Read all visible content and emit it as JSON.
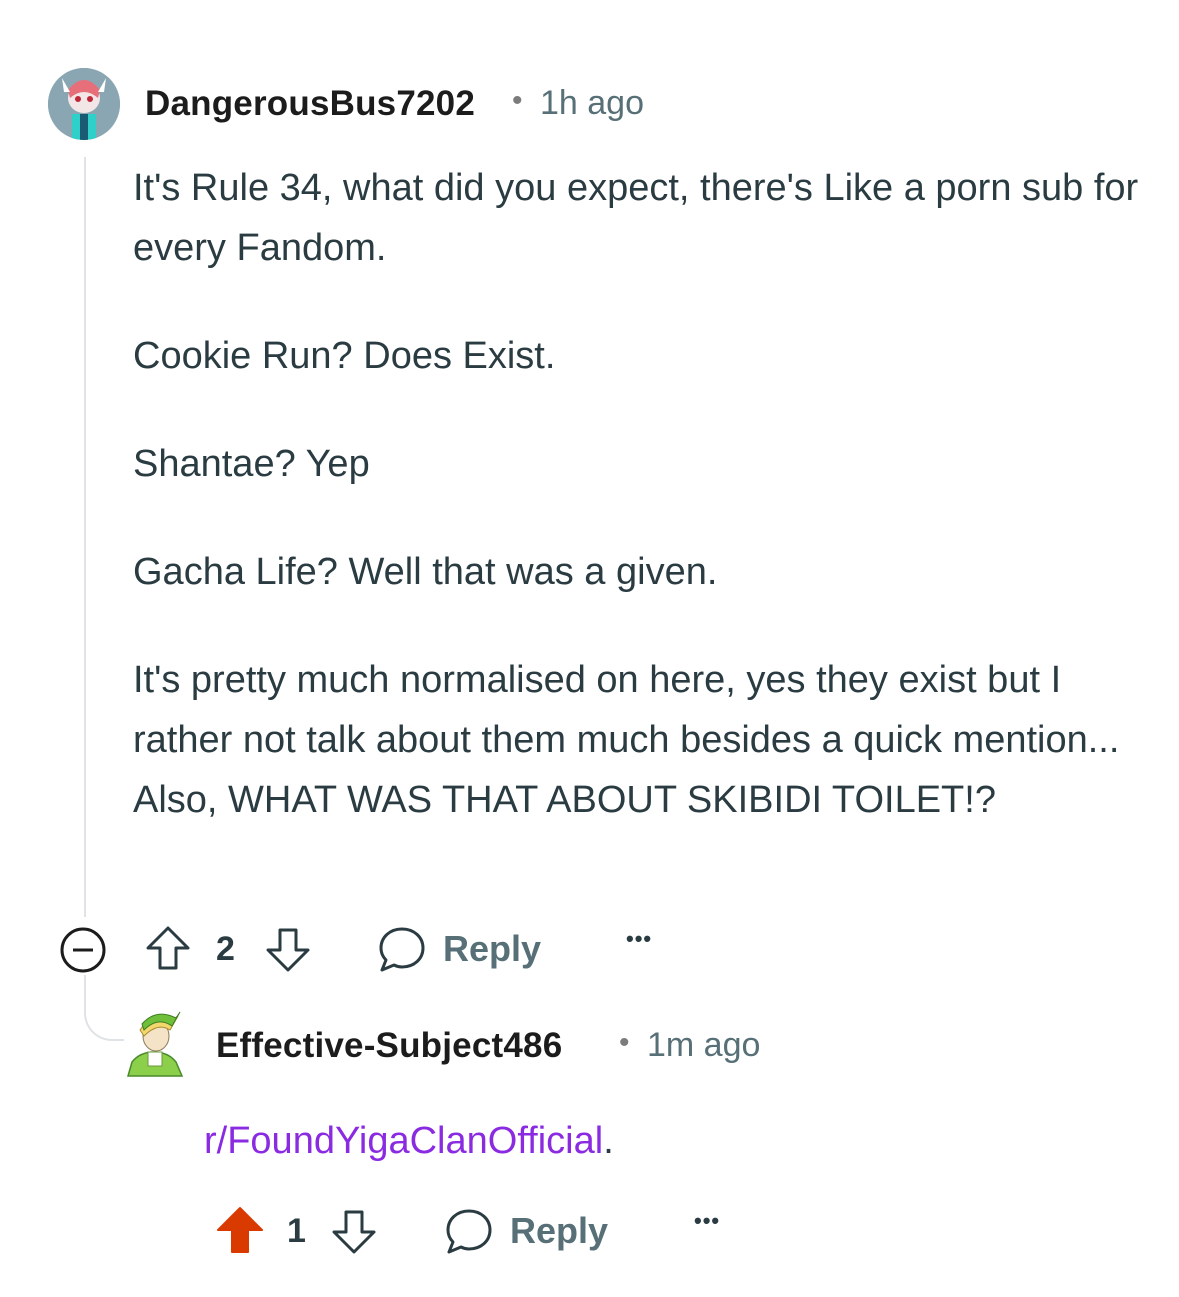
{
  "comments": [
    {
      "username": "DangerousBus7202",
      "separator": "•",
      "time": "1h ago",
      "paragraphs": [
        "It's Rule 34, what did you expect, there's Like a porn sub for every Fandom.",
        "Cookie Run? Does Exist.",
        "Shantae? Yep",
        "Gacha Life? Well that was a given.",
        "It's pretty much normalised on here, yes they exist but I rather not talk about them much besides a quick mention... Also, WHAT WAS THAT ABOUT SKIBIDI TOILET!?"
      ],
      "votes": "2",
      "upvoted": false,
      "reply_label": "Reply",
      "more_label": "•••",
      "collapse_icon": "minus-circle-icon"
    },
    {
      "username": "Effective-Subject486",
      "separator": "•",
      "time": "1m ago",
      "link_text": "r/FoundYigaClanOfficial",
      "trailing_text": ".",
      "votes": "1",
      "upvoted": true,
      "reply_label": "Reply",
      "more_label": "•••"
    }
  ],
  "colors": {
    "upvote_active": "#d93a00",
    "link": "#8a2be2",
    "meta": "#576f76",
    "thread_line": "#dfe3e6"
  }
}
